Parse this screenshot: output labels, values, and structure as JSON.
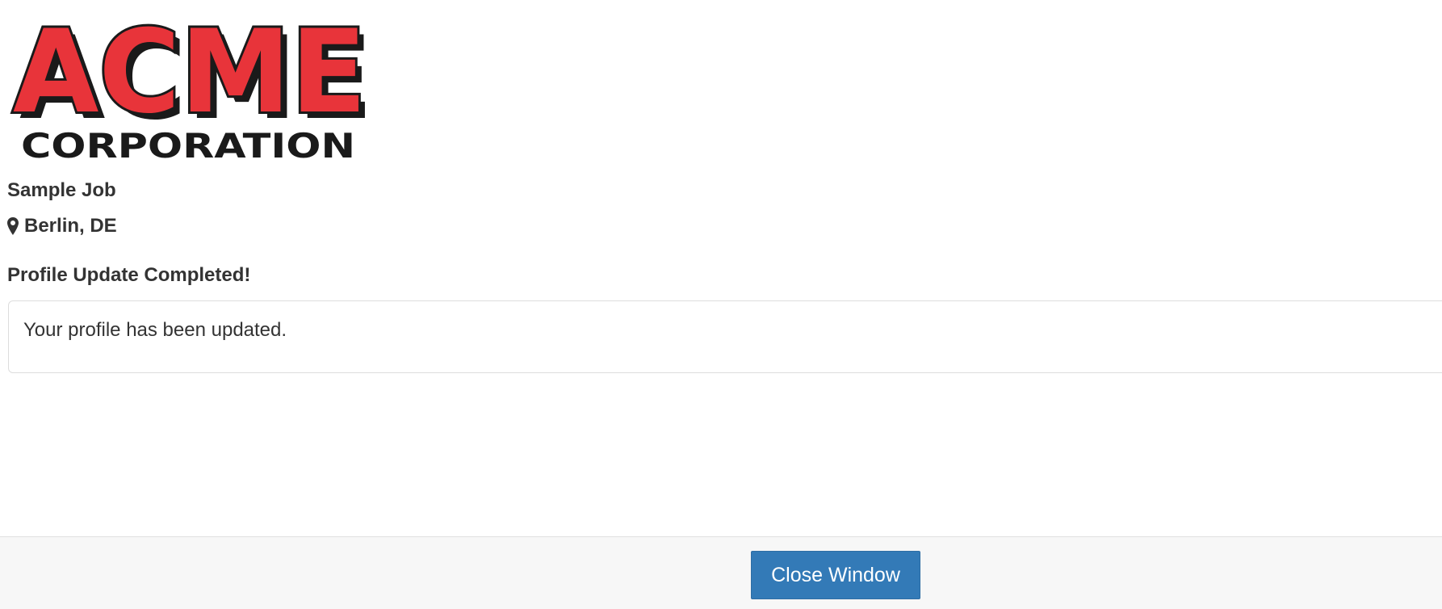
{
  "logo": {
    "line1": "ACME",
    "line2": "CORPORATION",
    "colors": {
      "red": "#e8343a",
      "outline": "#1a1a1a"
    }
  },
  "job": {
    "title": "Sample Job",
    "location_icon": "map-pin-icon",
    "location": "Berlin, DE"
  },
  "status": {
    "heading": "Profile Update Completed!",
    "message": "Your profile has been updated."
  },
  "footer": {
    "close_label": "Close Window",
    "button_color": "#337ab7"
  }
}
